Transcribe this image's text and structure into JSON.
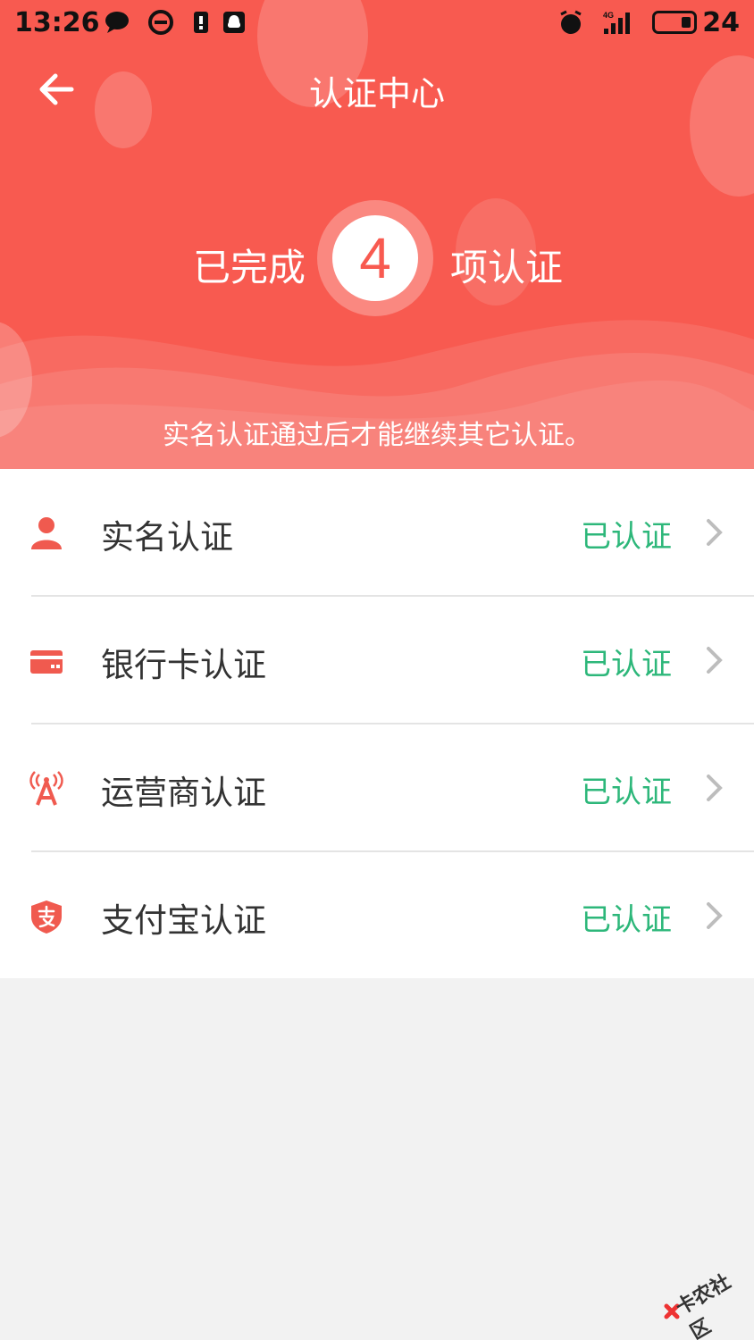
{
  "status_bar": {
    "time": "13:26",
    "battery": "24",
    "network": "4G"
  },
  "header": {
    "title": "认证中心",
    "completed_prefix": "已完成",
    "completed_count": "4",
    "completed_suffix": "项认证",
    "hint": "实名认证通过后才能继续其它认证。",
    "background_color": "#f85a50"
  },
  "list": {
    "items": [
      {
        "label": "实名认证",
        "status": "已认证",
        "icon": "person-icon"
      },
      {
        "label": "银行卡认证",
        "status": "已认证",
        "icon": "bank-card-icon"
      },
      {
        "label": "运营商认证",
        "status": "已认证",
        "icon": "signal-tower-icon"
      },
      {
        "label": "支付宝认证",
        "status": "已认证",
        "icon": "alipay-shield-icon"
      }
    ],
    "status_color": "#2db77a",
    "icon_color": "#f05a4f"
  },
  "watermark": {
    "text": "卡农社区"
  }
}
